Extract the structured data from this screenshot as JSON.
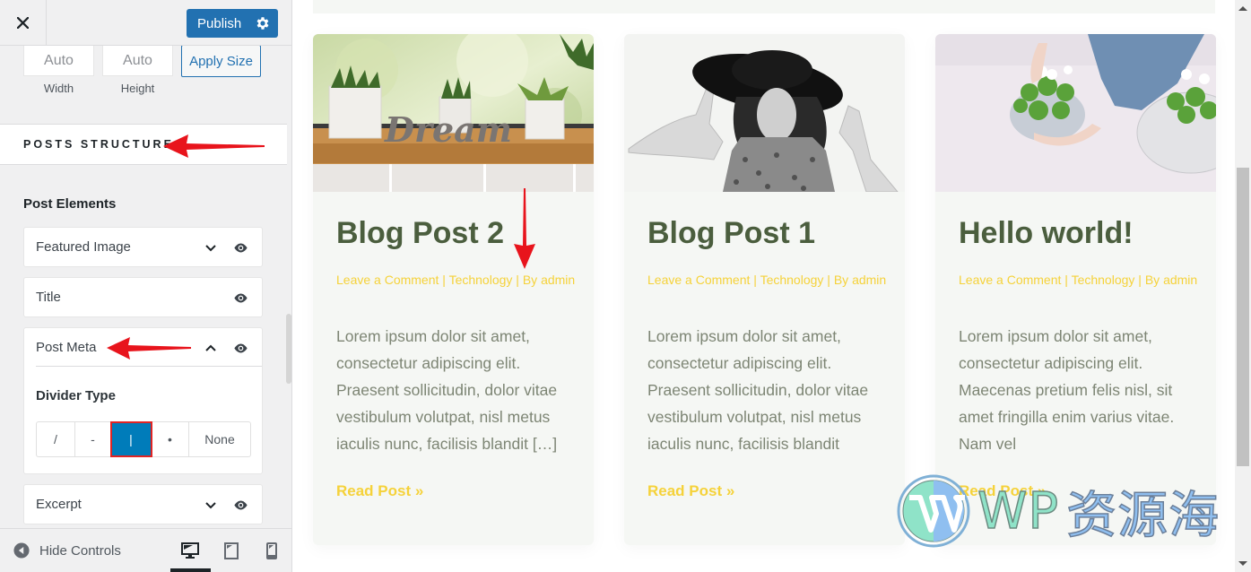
{
  "sidebar": {
    "publish_label": "Publish",
    "image_size": {
      "width_value": "Auto",
      "height_value": "Auto",
      "width_label": "Width",
      "height_label": "Height",
      "apply_label": "Apply Size"
    },
    "section_title": "POSTS STRUCTURE",
    "group_title": "Post Elements",
    "elements": [
      {
        "label": "Featured Image",
        "expanded": false
      },
      {
        "label": "Title",
        "expanded": false
      },
      {
        "label": "Post Meta",
        "expanded": true
      },
      {
        "label": "Excerpt",
        "expanded": false
      }
    ],
    "post_meta": {
      "sub_title": "Divider Type",
      "divider_options": [
        "/",
        "-",
        "|",
        "•",
        "None"
      ],
      "selected": "|"
    },
    "footer": {
      "hide_controls_label": "Hide Controls",
      "devices": [
        "desktop",
        "tablet",
        "mobile"
      ],
      "active_device": "desktop"
    }
  },
  "posts": [
    {
      "title": "Blog Post 2",
      "meta": {
        "comments": "Leave a Comment",
        "sep1": " | ",
        "category": "Technology",
        "sep2": " | ",
        "by": "By",
        "author": "admin"
      },
      "excerpt": "Lorem ipsum dolor sit amet, consectetur adipiscing elit. Praesent sollicitudin, dolor vitae vestibulum volutpat, nisl metus iaculis nunc, facilisis blandit […]",
      "read_more": "Read Post »",
      "image": "plants-dream-windowsill"
    },
    {
      "title": "Blog Post 1",
      "meta": {
        "comments": "Leave a Comment",
        "sep1": " | ",
        "category": "Technology",
        "sep2": " | ",
        "by": "By",
        "author": "admin"
      },
      "excerpt": "Lorem ipsum dolor sit amet, consectetur adipiscing elit. Praesent sollicitudin, dolor vitae vestibulum volutpat, nisl metus iaculis nunc, facilisis blandit",
      "read_more": "Read Post »",
      "image": "woman-black-hat"
    },
    {
      "title": "Hello world!",
      "meta": {
        "comments": "Leave a Comment",
        "sep1": " | ",
        "category": "Technology",
        "sep2": " | ",
        "by": "By",
        "author": "admin"
      },
      "excerpt": "Lorem ipsum dolor sit amet, consectetur adipiscing elit. Maecenas pretium felis nisl, sit amet fringilla enim varius vitae. Nam vel",
      "read_more": "Read Post »",
      "image": "hands-potted-plants"
    }
  ],
  "watermark": {
    "wp": "WP",
    "cn": "资源海"
  },
  "colors": {
    "primary": "#2271b1",
    "selected_option": "#007cba",
    "highlight_border": "#e02424",
    "post_title": "#4b5e3e",
    "post_meta": "#f5d23a",
    "excerpt": "#7d8574",
    "card_bg": "#f5f7f4",
    "annotation_arrow": "#e8141c"
  }
}
